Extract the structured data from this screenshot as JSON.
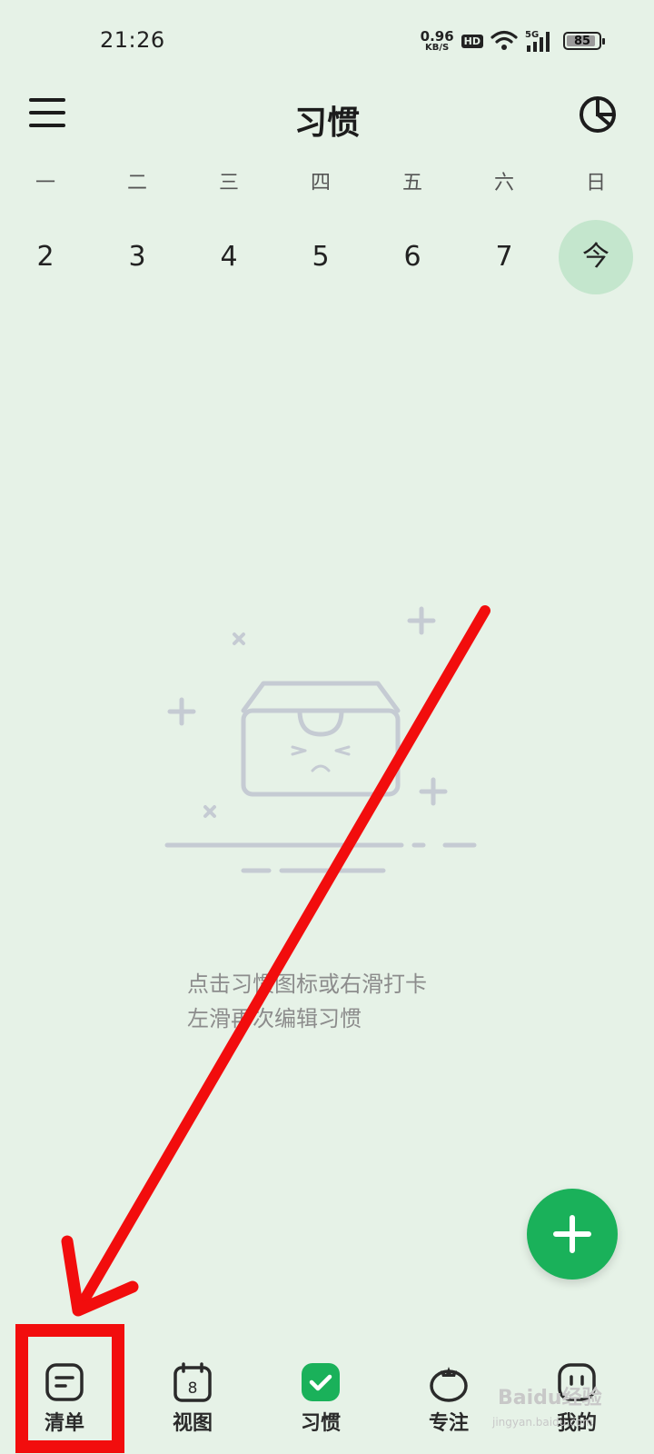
{
  "status_bar": {
    "time": "21:26",
    "net_speed_value": "0.96",
    "net_speed_unit": "KB/S",
    "hd_badge": "HD",
    "network_type": "5G",
    "battery": "85"
  },
  "header": {
    "title": "习惯"
  },
  "week": {
    "weekdays": [
      "一",
      "二",
      "三",
      "四",
      "五",
      "六",
      "日"
    ],
    "dates": [
      "2",
      "3",
      "4",
      "5",
      "6",
      "7",
      "今"
    ]
  },
  "empty_state": {
    "line1": "点击习惯图标或右滑打卡",
    "line2": "左滑再次编辑习惯"
  },
  "bottom_nav": {
    "items": [
      {
        "label": "清单",
        "icon": "list-icon"
      },
      {
        "label": "视图",
        "icon": "calendar-icon",
        "badge": "8"
      },
      {
        "label": "习惯",
        "icon": "habit-check-icon"
      },
      {
        "label": "专注",
        "icon": "tomato-icon"
      },
      {
        "label": "我的",
        "icon": "profile-face-icon"
      }
    ]
  },
  "colors": {
    "background": "#e6f2e7",
    "accent_green": "#1ab15a",
    "today_highlight": "#c4e6cd",
    "annotation_red": "#f20d0d"
  },
  "watermark": "Baidu经验",
  "watermark_sub": "jingyan.baidu.com"
}
